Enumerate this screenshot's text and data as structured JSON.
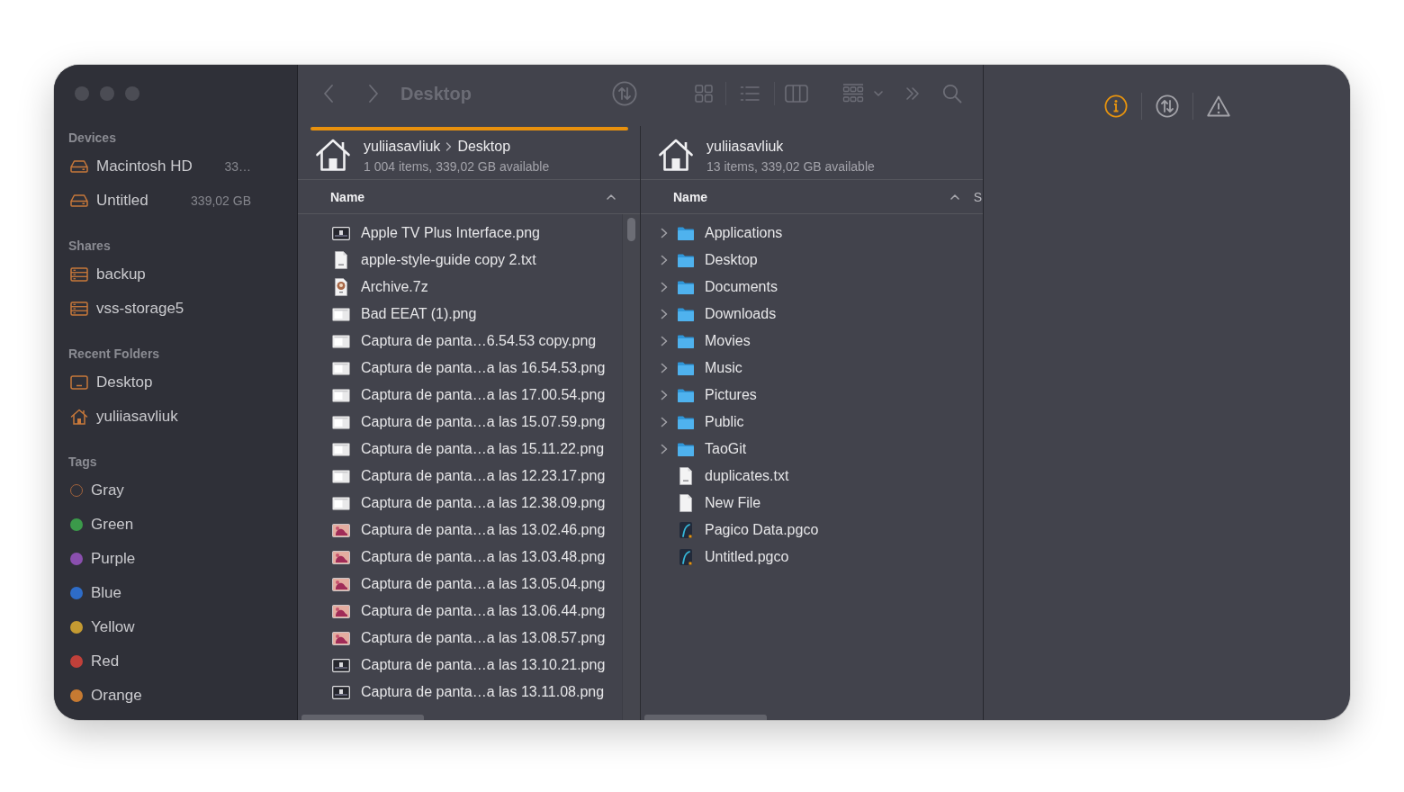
{
  "sidebar": {
    "sections": [
      {
        "title": "Devices",
        "items": [
          {
            "kind": "drive",
            "label": "Macintosh HD",
            "detail": "33…"
          },
          {
            "kind": "drive",
            "label": "Untitled",
            "detail": "339,02 GB"
          }
        ]
      },
      {
        "title": "Shares",
        "items": [
          {
            "kind": "server",
            "label": "backup"
          },
          {
            "kind": "server",
            "label": "vss-storage5"
          }
        ]
      },
      {
        "title": "Recent Folders",
        "items": [
          {
            "kind": "desktop",
            "label": "Desktop"
          },
          {
            "kind": "home",
            "label": "yuliiasavliuk"
          }
        ]
      }
    ],
    "tags": {
      "title": "Tags",
      "items": [
        {
          "kind": "hollow",
          "label": "Gray",
          "color": "#a0623c"
        },
        {
          "kind": "filled",
          "label": "Green",
          "color": "#3b9a4a"
        },
        {
          "kind": "filled",
          "label": "Purple",
          "color": "#8a4fae"
        },
        {
          "kind": "filled",
          "label": "Blue",
          "color": "#2e6cc8"
        },
        {
          "kind": "filled",
          "label": "Yellow",
          "color": "#c49a32"
        },
        {
          "kind": "filled",
          "label": "Red",
          "color": "#c0403a"
        },
        {
          "kind": "filled",
          "label": "Orange",
          "color": "#c67a32"
        }
      ]
    }
  },
  "toolbar": {
    "title": "Desktop"
  },
  "panes": [
    {
      "active": true,
      "path": [
        "yuliiasavliuk",
        "Desktop"
      ],
      "summary": "1 004 items, 339,02 GB available",
      "columns": [
        {
          "label": "Name",
          "sorted": true
        }
      ],
      "rows": [
        {
          "kind": "image-dark",
          "name": "Apple TV Plus Interface.png"
        },
        {
          "kind": "text",
          "name": "apple-style-guide copy 2.txt"
        },
        {
          "kind": "archive",
          "name": "Archive.7z"
        },
        {
          "kind": "image",
          "name": "Bad EEAT (1).png"
        },
        {
          "kind": "image",
          "name": "Captura de panta…6.54.53 copy.png"
        },
        {
          "kind": "image",
          "name": "Captura de panta…a las 16.54.53.png"
        },
        {
          "kind": "image",
          "name": "Captura de panta…a las 17.00.54.png"
        },
        {
          "kind": "image",
          "name": "Captura de panta…a las 15.07.59.png"
        },
        {
          "kind": "image",
          "name": "Captura de panta…a las 15.11.22.png"
        },
        {
          "kind": "image",
          "name": "Captura de panta…a las 12.23.17.png"
        },
        {
          "kind": "image",
          "name": "Captura de panta…a las 12.38.09.png"
        },
        {
          "kind": "image-warm",
          "name": "Captura de panta…a las 13.02.46.png"
        },
        {
          "kind": "image-warm",
          "name": "Captura de panta…a las 13.03.48.png"
        },
        {
          "kind": "image-warm",
          "name": "Captura de panta…a las 13.05.04.png"
        },
        {
          "kind": "image-warm",
          "name": "Captura de panta…a las 13.06.44.png"
        },
        {
          "kind": "image-warm",
          "name": "Captura de panta…a las 13.08.57.png"
        },
        {
          "kind": "image-dark",
          "name": "Captura de panta…a las 13.10.21.png"
        },
        {
          "kind": "image-dark",
          "name": "Captura de panta…a las 13.11.08.png"
        }
      ]
    },
    {
      "active": false,
      "path": [
        "yuliiasavliuk"
      ],
      "summary": "13 items, 339,02 GB available",
      "columns": [
        {
          "label": "Name",
          "sorted": true
        },
        {
          "label": "S",
          "sorted": false
        }
      ],
      "rows": [
        {
          "kind": "folder",
          "name": "Applications",
          "expanded": false
        },
        {
          "kind": "folder",
          "name": "Desktop",
          "expanded": false
        },
        {
          "kind": "folder",
          "name": "Documents",
          "expanded": false
        },
        {
          "kind": "folder",
          "name": "Downloads",
          "expanded": false
        },
        {
          "kind": "folder",
          "name": "Movies",
          "expanded": false
        },
        {
          "kind": "folder",
          "name": "Music",
          "expanded": false
        },
        {
          "kind": "folder",
          "name": "Pictures",
          "expanded": false
        },
        {
          "kind": "folder",
          "name": "Public",
          "expanded": false
        },
        {
          "kind": "folder",
          "name": "TaoGit",
          "expanded": false
        },
        {
          "kind": "text",
          "name": "duplicates.txt"
        },
        {
          "kind": "blank",
          "name": "New File"
        },
        {
          "kind": "app-document",
          "name": "Pagico Data.pgco"
        },
        {
          "kind": "app-document",
          "name": "Untitled.pgco"
        }
      ]
    }
  ],
  "inspector_tabs": [
    {
      "kind": "info",
      "selected": true
    },
    {
      "kind": "sync",
      "selected": false
    },
    {
      "kind": "warning",
      "selected": false
    }
  ]
}
